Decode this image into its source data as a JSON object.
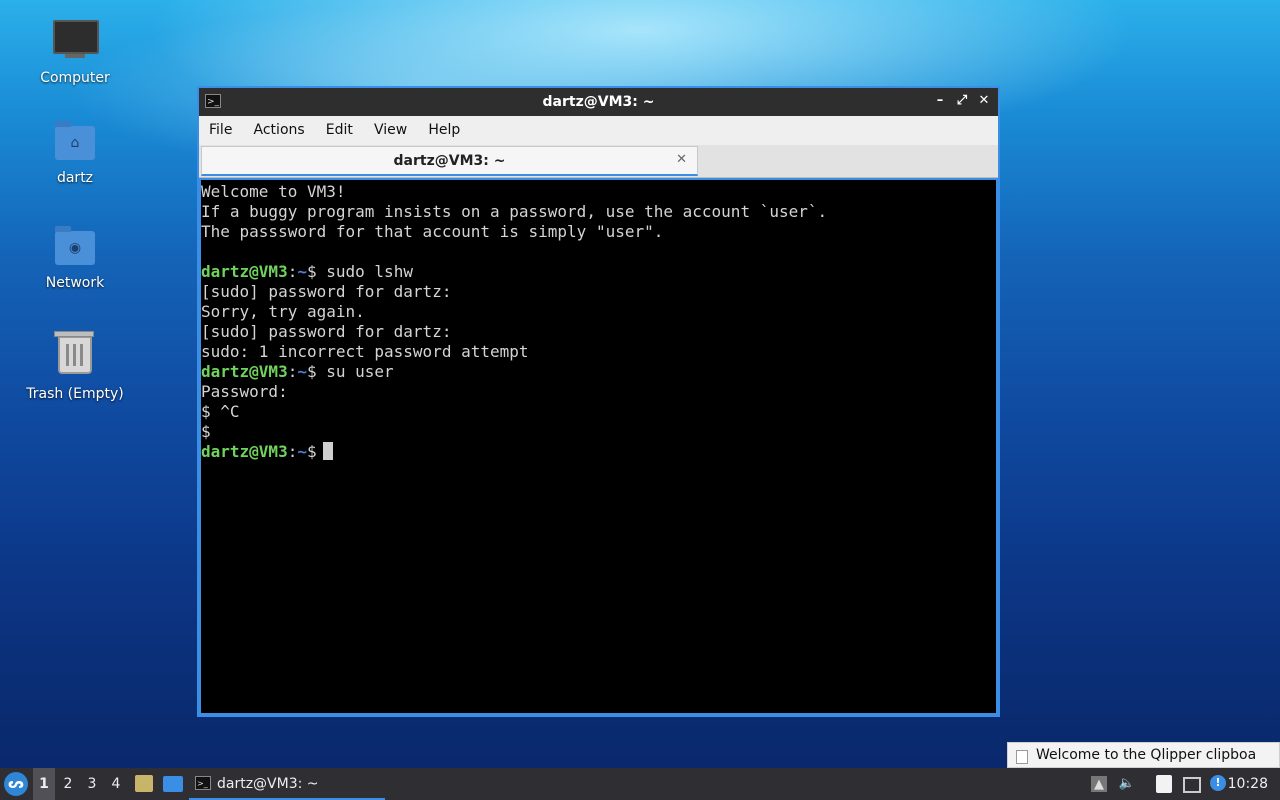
{
  "desktop": {
    "icons": [
      {
        "label": "Computer",
        "icon": "computer-icon"
      },
      {
        "label": "dartz",
        "icon": "home-folder-icon"
      },
      {
        "label": "Network",
        "icon": "network-folder-icon"
      },
      {
        "label": "Trash (Empty)",
        "icon": "trash-icon"
      }
    ]
  },
  "window": {
    "title": "dartz@VM3: ~",
    "buttons": {
      "minimize": "–",
      "maximize": "⤢",
      "close": "✕"
    },
    "menu": [
      "File",
      "Actions",
      "Edit",
      "View",
      "Help"
    ],
    "tab": {
      "label": "dartz@VM3: ~",
      "close": "✕"
    }
  },
  "terminal": {
    "lines": [
      {
        "type": "text",
        "text": "Welcome to VM3!"
      },
      {
        "type": "text",
        "text": "If a buggy program insists on a password, use the account `user`."
      },
      {
        "type": "text",
        "text": "The passsword for that account is simply \"user\"."
      },
      {
        "type": "text",
        "text": ""
      },
      {
        "type": "prompt",
        "user": "dartz@VM3",
        "path": "~",
        "cmd": " sudo lshw"
      },
      {
        "type": "text",
        "text": "[sudo] password for dartz:"
      },
      {
        "type": "text",
        "text": "Sorry, try again."
      },
      {
        "type": "text",
        "text": "[sudo] password for dartz:"
      },
      {
        "type": "text",
        "text": "sudo: 1 incorrect password attempt"
      },
      {
        "type": "prompt",
        "user": "dartz@VM3",
        "path": "~",
        "cmd": " su user"
      },
      {
        "type": "text",
        "text": "Password:"
      },
      {
        "type": "text",
        "text": "$ ^C"
      },
      {
        "type": "text",
        "text": "$"
      },
      {
        "type": "prompt",
        "user": "dartz@VM3",
        "path": "~",
        "cmd": "",
        "cursor": true
      }
    ]
  },
  "notification": {
    "text": "Welcome to the Qlipper clipboa"
  },
  "taskbar": {
    "workspaces": [
      "1",
      "2",
      "3",
      "4"
    ],
    "active_workspace": "1",
    "task_label": "dartz@VM3: ~",
    "clock": "10:28"
  },
  "colors": {
    "accent": "#3a8ee6",
    "prompt_user": "#6fd35c",
    "prompt_path": "#4f7fd6"
  }
}
